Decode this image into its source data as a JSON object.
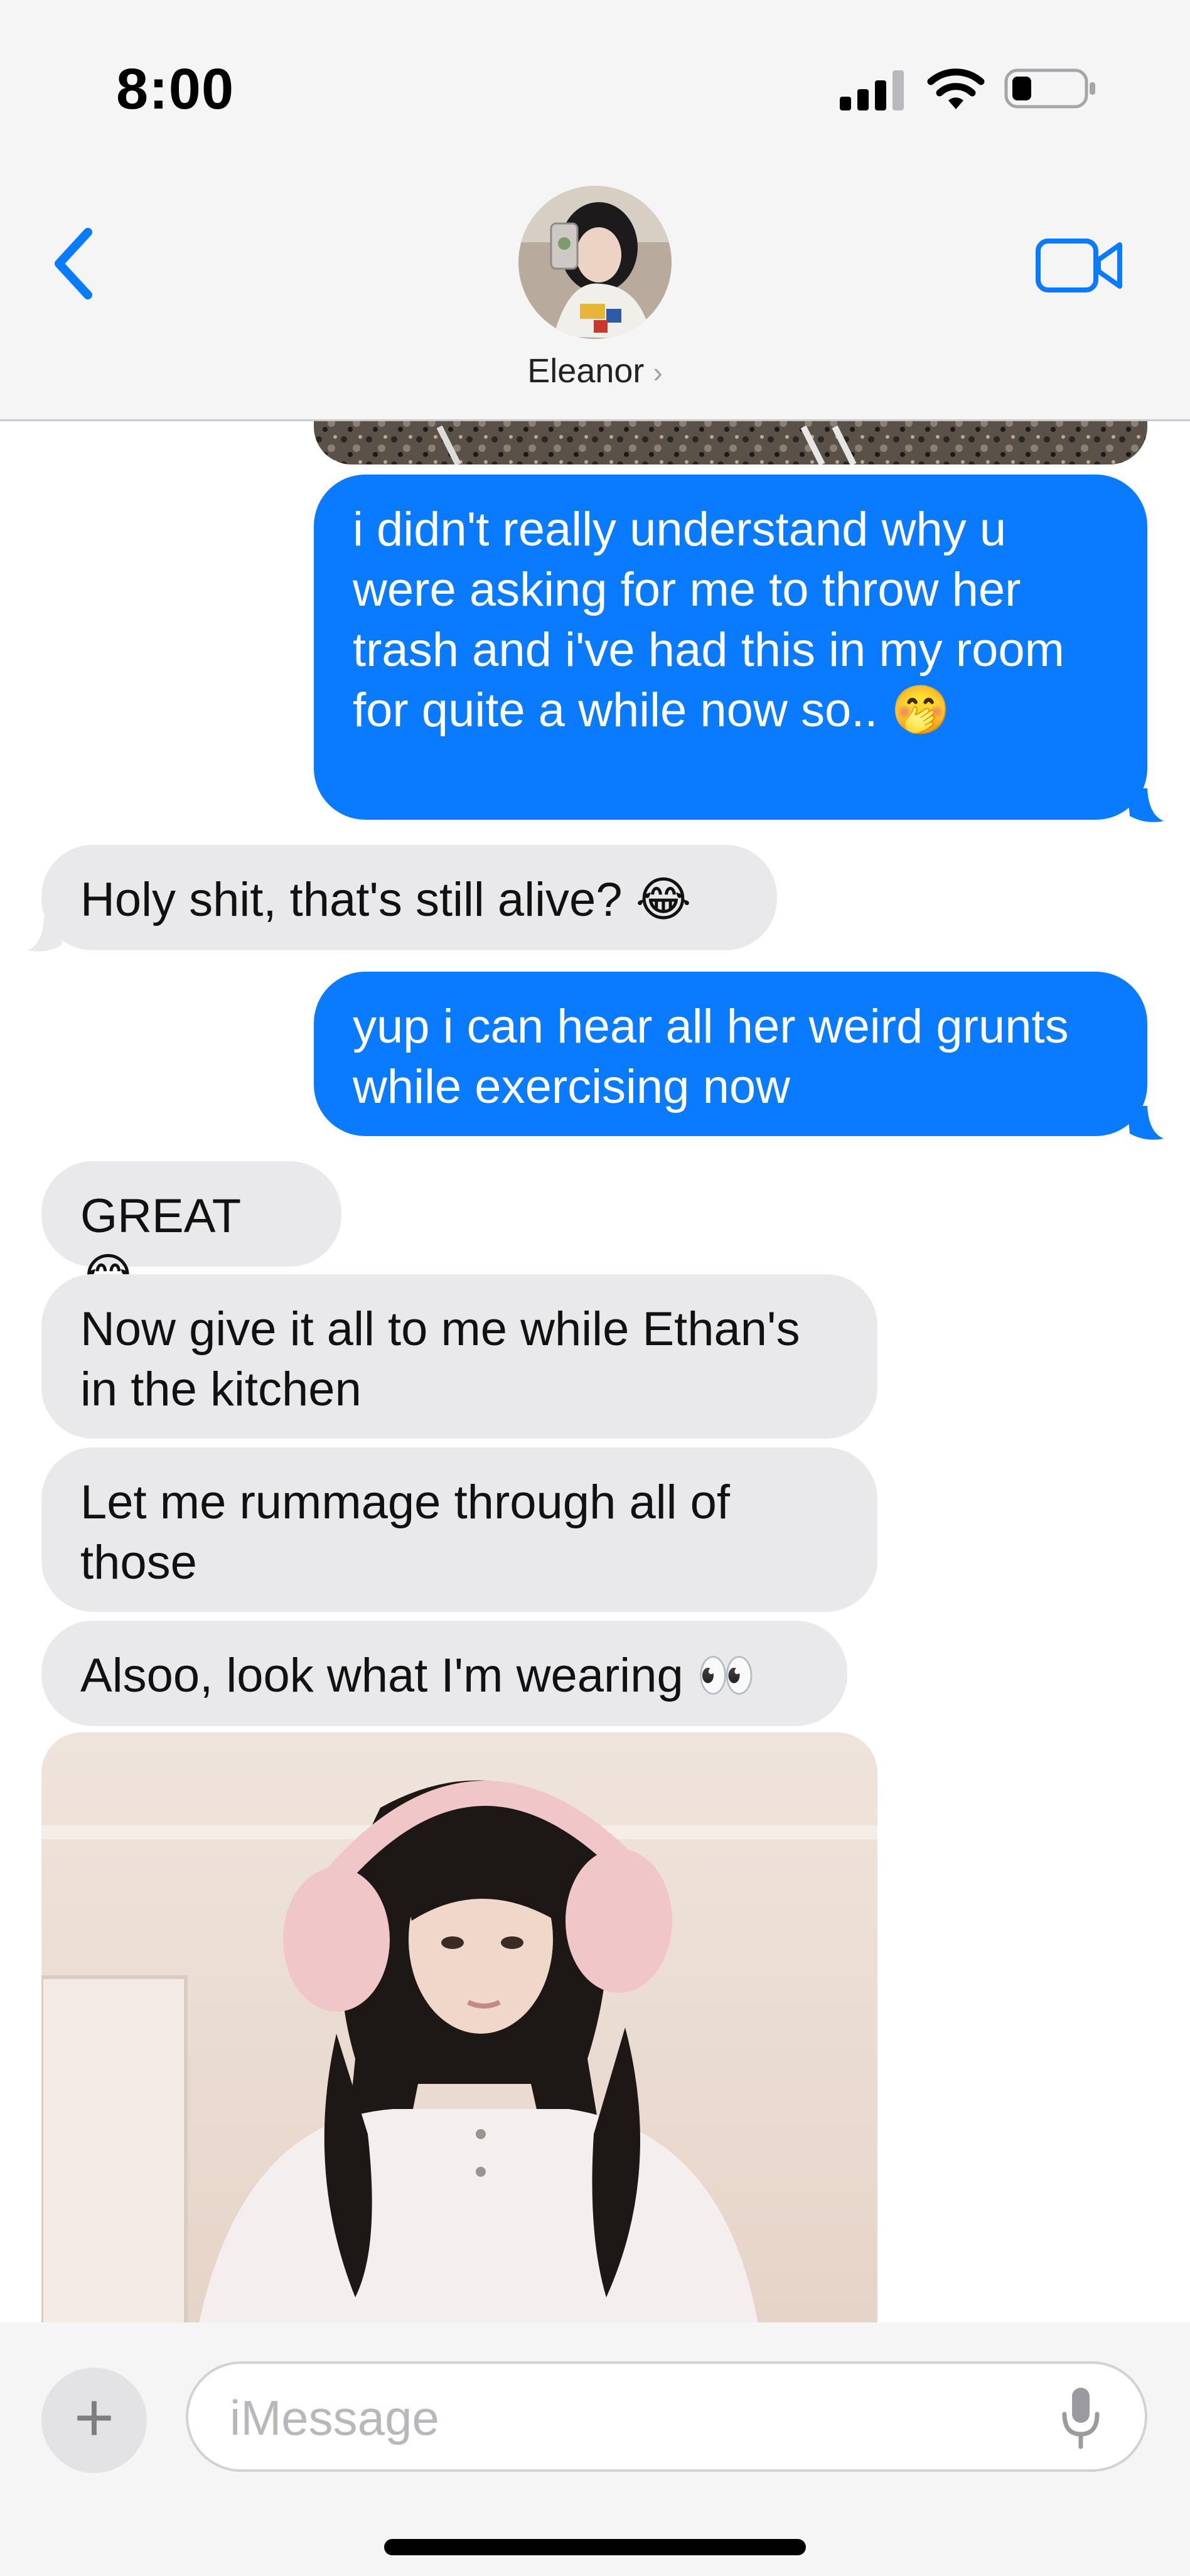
{
  "status_bar": {
    "time": "8:00"
  },
  "header": {
    "contact_name": "Eleanor",
    "contact_chevron": "›",
    "icons": [
      "back-chevron-icon",
      "video-call-icon"
    ]
  },
  "messages": [
    {
      "direction": "sent",
      "text": "i didn't really understand why u were asking for me to throw her trash and i've had this in my room for quite a while now so.. 🤭"
    },
    {
      "direction": "received",
      "text": "Holy shit, that's still alive? 😂"
    },
    {
      "direction": "sent",
      "text": "yup i can hear all her weird grunts while exercising now"
    },
    {
      "direction": "received",
      "text": "GREAT 😂"
    },
    {
      "direction": "received",
      "text": "Now give it all to me while Ethan's in the kitchen"
    },
    {
      "direction": "received",
      "text": "Let me rummage through all of those"
    },
    {
      "direction": "received",
      "text": "Alsoo, look what I'm wearing 👀"
    },
    {
      "direction": "received",
      "type": "photo",
      "description_icon": "photo-attachment"
    }
  ],
  "composer": {
    "plus_label": "+",
    "placeholder": "iMessage",
    "icons": [
      "plus-icon",
      "microphone-icon"
    ]
  },
  "colors": {
    "sent_bubble": "#0a7bff",
    "received_bubble": "#e9e9eb",
    "accent": "#0a7bff"
  }
}
